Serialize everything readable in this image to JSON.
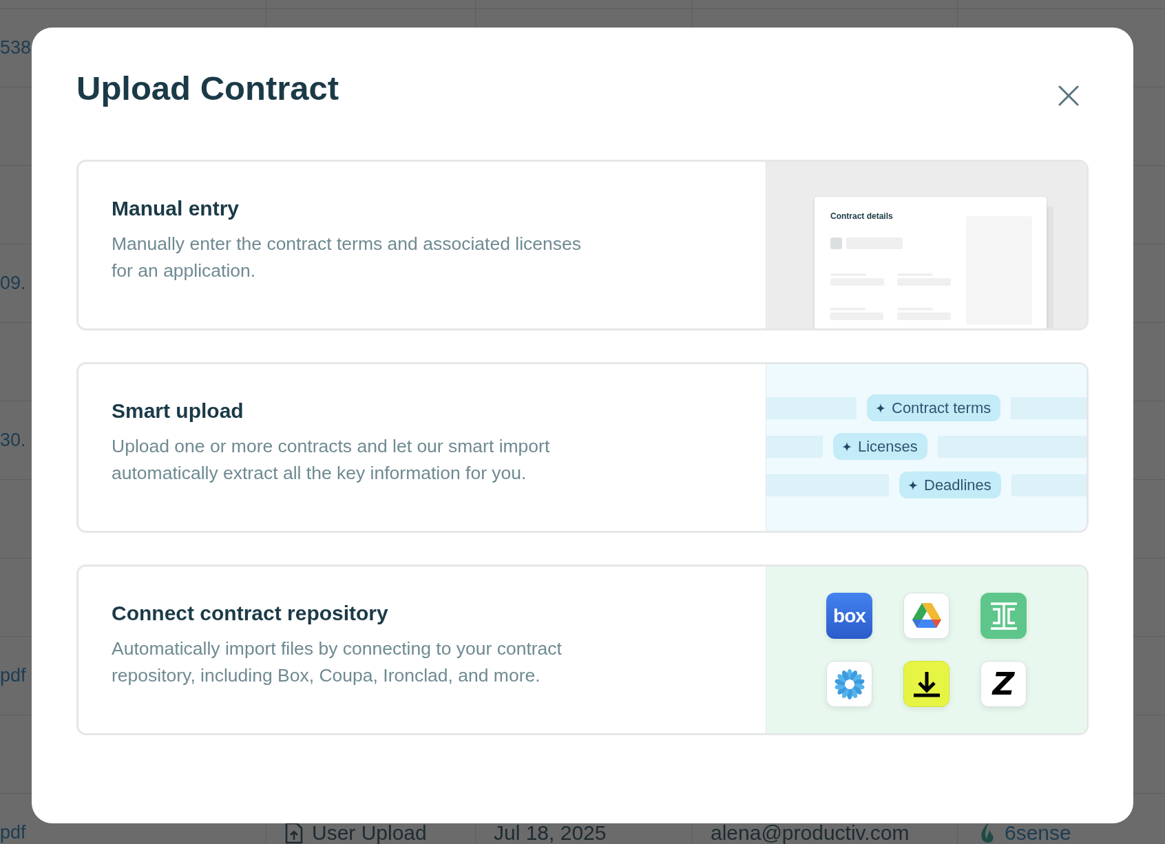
{
  "background_table": {
    "rows": [
      {
        "column_1": "538"
      },
      {},
      {},
      {
        "column_1": "09."
      },
      {},
      {
        "column_1": "30."
      },
      {},
      {},
      {
        "column_1": "pdf"
      },
      {},
      {
        "column_1": "pdf",
        "column_2": "User Upload",
        "column_3": "Jul 18, 2025",
        "column_4": "alena@productiv.com",
        "column_5": "6sense"
      }
    ]
  },
  "dialog": {
    "title": "Upload Contract",
    "options": [
      {
        "kind": "manual",
        "title": "Manual entry",
        "description": "Manually enter the contract terms and associated licenses for an application.",
        "preview": {
          "title": "Contract details"
        }
      },
      {
        "kind": "smart",
        "title": "Smart upload",
        "description": "Upload one or more contracts and let our smart import automatically extract all the key information for you.",
        "preview": {
          "tags": [
            "Contract terms",
            "Licenses",
            "Deadlines"
          ]
        }
      },
      {
        "kind": "repository",
        "title": "Connect contract repository",
        "description": "Automatically import files by connecting to your contract repository, including Box, Coupa, Ironclad, and more.",
        "preview": {
          "integrations": [
            {
              "kind": "box",
              "label": "box"
            },
            {
              "kind": "drive"
            },
            {
              "kind": "ironclad"
            },
            {
              "kind": "coupa"
            },
            {
              "kind": "download"
            },
            {
              "kind": "zip",
              "label": "Z"
            }
          ]
        }
      }
    ]
  }
}
